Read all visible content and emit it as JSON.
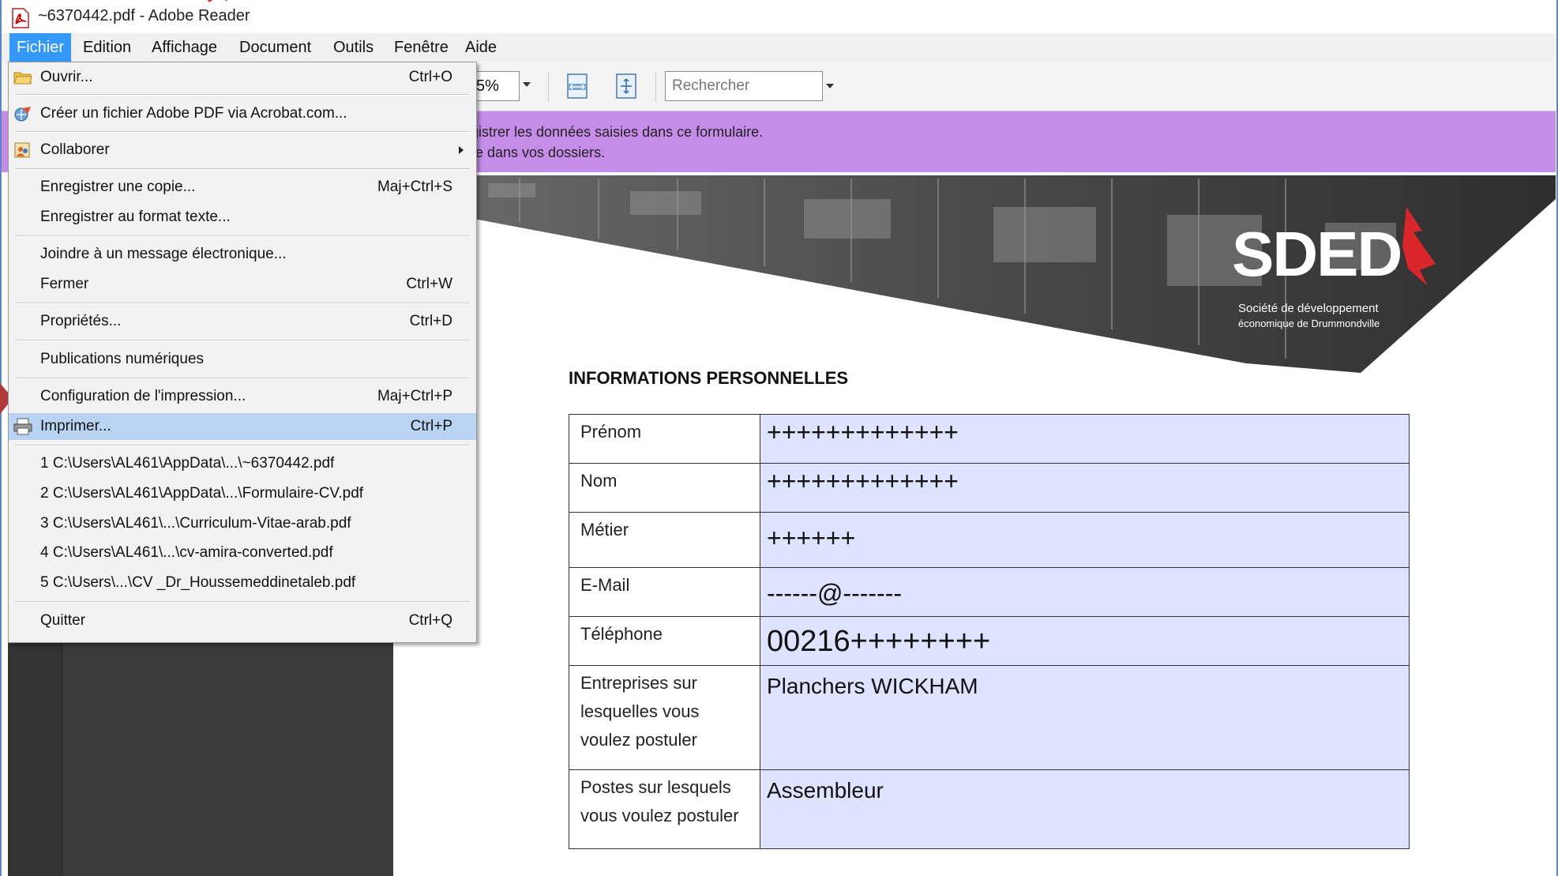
{
  "window": {
    "title": "~6370442.pdf - Adobe Reader"
  },
  "menubar": [
    {
      "label": "Fichier",
      "active": true
    },
    {
      "label": "Edition"
    },
    {
      "label": "Affichage"
    },
    {
      "label": "Document"
    },
    {
      "label": "Outils"
    },
    {
      "label": "Fenêtre"
    },
    {
      "label": "Aide"
    }
  ],
  "toolbar": {
    "zoom_value": "5%",
    "search_placeholder": "Rechercher"
  },
  "notice": {
    "line1": "gistrer les données saisies dans ce formulaire.",
    "line2": "e dans vos dossiers.",
    "color": "#c58de8"
  },
  "file_menu": {
    "items": [
      {
        "label": "Ouvrir...",
        "shortcut": "Ctrl+O",
        "icon": "folder-icon"
      },
      {
        "label": "Créer un fichier Adobe PDF via Acrobat.com...",
        "shortcut": "",
        "icon": "acrobat-com-icon"
      },
      {
        "label": "Collaborer",
        "shortcut": "",
        "icon": "collaborate-icon",
        "submenu": true
      },
      {
        "label": "Enregistrer une copie...",
        "shortcut": "Maj+Ctrl+S"
      },
      {
        "label": "Enregistrer au format texte...",
        "shortcut": ""
      },
      {
        "label": "Joindre à un message électronique...",
        "shortcut": ""
      },
      {
        "label": "Fermer",
        "shortcut": "Ctrl+W"
      },
      {
        "label": "Propriétés...",
        "shortcut": "Ctrl+D"
      },
      {
        "label": "Publications numériques",
        "shortcut": ""
      },
      {
        "label": "Configuration de l'impression...",
        "shortcut": "Maj+Ctrl+P"
      },
      {
        "label": "Imprimer...",
        "shortcut": "Ctrl+P",
        "icon": "printer-icon",
        "highlighted": true
      },
      {
        "label": "1 C:\\Users\\AL461\\AppData\\...\\~6370442.pdf",
        "shortcut": ""
      },
      {
        "label": "2 C:\\Users\\AL461\\AppData\\...\\Formulaire-CV.pdf",
        "shortcut": ""
      },
      {
        "label": "3 C:\\Users\\AL461\\...\\Curriculum-Vitae-arab.pdf",
        "shortcut": ""
      },
      {
        "label": "4 C:\\Users\\AL461\\...\\cv-amira-converted.pdf",
        "shortcut": ""
      },
      {
        "label": "5 C:\\Users\\...\\CV _Dr_Houssemeddinetaleb.pdf",
        "shortcut": ""
      },
      {
        "label": "Quitter",
        "shortcut": "Ctrl+Q"
      }
    ],
    "highlight_color": "#b9d3f2"
  },
  "document": {
    "logo_text": "SDED",
    "logo_sub1": "Société de développement",
    "logo_sub2": "économique de Drummondville",
    "section_title": "INFORMATIONS PERSONNELLES",
    "form_fill_color": "#dee3ff",
    "rows": [
      {
        "label": "Prénom",
        "value": "+++++++++++++"
      },
      {
        "label": "Nom",
        "value": "+++++++++++++"
      },
      {
        "label": "Métier",
        "value": "++++++"
      },
      {
        "label": "E-Mail",
        "value": "------@-------"
      },
      {
        "label": "Téléphone",
        "value": "00216++++++++"
      },
      {
        "label": "Entreprises sur lesquelles vous voulez postuler",
        "value": "Planchers WICKHAM"
      },
      {
        "label": "Postes sur lesquels vous voulez postuler",
        "value": "Assembleur"
      }
    ]
  }
}
